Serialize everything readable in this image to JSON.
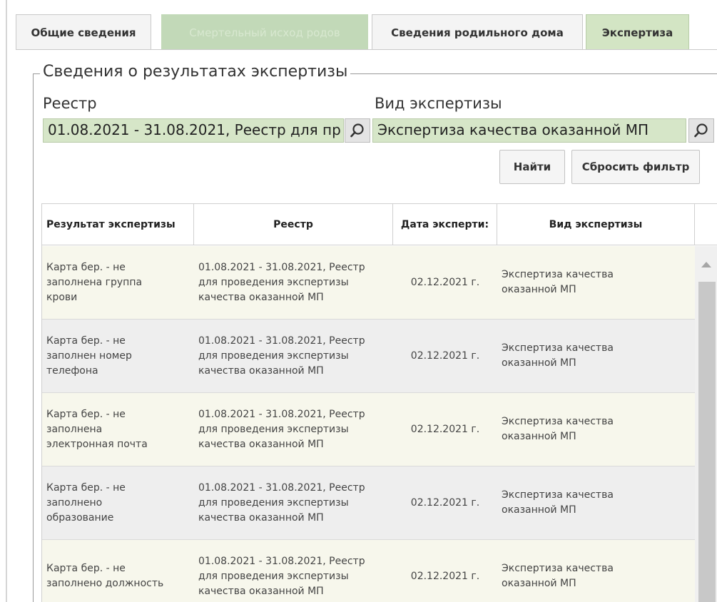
{
  "tabs": [
    {
      "label": "Общие сведения"
    },
    {
      "label": "Смертельный исход родов"
    },
    {
      "label": "Сведения родильного дома"
    },
    {
      "label": "Экспертиза"
    }
  ],
  "section": {
    "legend": "Сведения о результатах экспертизы",
    "registry_label": "Реестр",
    "registry_value": "01.08.2021 - 31.08.2021, Реестр для пр",
    "type_label": "Вид экспертизы",
    "type_value": "Экспертиза качества оказанной МП",
    "find_button": "Найти",
    "reset_button": "Сбросить фильтр"
  },
  "table": {
    "headers": [
      "Результат экспертизы",
      "Реестр",
      "Дата эксперти:",
      "Вид экспертизы"
    ],
    "rows": [
      {
        "result": [
          "Карта бер. - не",
          "заполнена группа",
          "крови"
        ],
        "registry": [
          "01.08.2021 - 31.08.2021, Реестр",
          "для проведения экспертизы",
          "качества оказанной МП"
        ],
        "date": "02.12.2021 г.",
        "type": [
          "Экспертиза качества",
          "оказанной МП"
        ]
      },
      {
        "result": [
          "Карта бер. - не",
          "заполнен номер",
          "телефона"
        ],
        "registry": [
          "01.08.2021 - 31.08.2021, Реестр",
          "для проведения экспертизы",
          "качества оказанной МП"
        ],
        "date": "02.12.2021 г.",
        "type": [
          "Экспертиза качества",
          "оказанной МП"
        ]
      },
      {
        "result": [
          "Карта бер. - не",
          "заполнена",
          "электронная почта"
        ],
        "registry": [
          "01.08.2021 - 31.08.2021, Реестр",
          "для проведения экспертизы",
          "качества оказанной МП"
        ],
        "date": "02.12.2021 г.",
        "type": [
          "Экспертиза качества",
          "оказанной МП"
        ]
      },
      {
        "result": [
          "Карта бер. - не",
          "заполнено",
          "образование"
        ],
        "registry": [
          "01.08.2021 - 31.08.2021, Реестр",
          "для проведения экспертизы",
          "качества оказанной МП"
        ],
        "date": "02.12.2021 г.",
        "type": [
          "Экспертиза качества",
          "оказанной МП"
        ]
      },
      {
        "result": [
          "Карта бер. - не",
          "заполнено должность"
        ],
        "registry": [
          "01.08.2021 - 31.08.2021, Реестр",
          "для проведения экспертизы",
          "качества оказанной МП"
        ],
        "date": "02.12.2021 г.",
        "type": [
          "Экспертиза качества",
          "оказанной МП"
        ]
      }
    ]
  },
  "icons": {
    "search": "search-icon",
    "scroll_up": "scroll-up-arrow-icon"
  },
  "colors": {
    "active_tab": "#d3e5c4",
    "lookup_bg": "#d6e6c8",
    "row_even": "#f7f7ec",
    "row_odd": "#eeeeee"
  }
}
